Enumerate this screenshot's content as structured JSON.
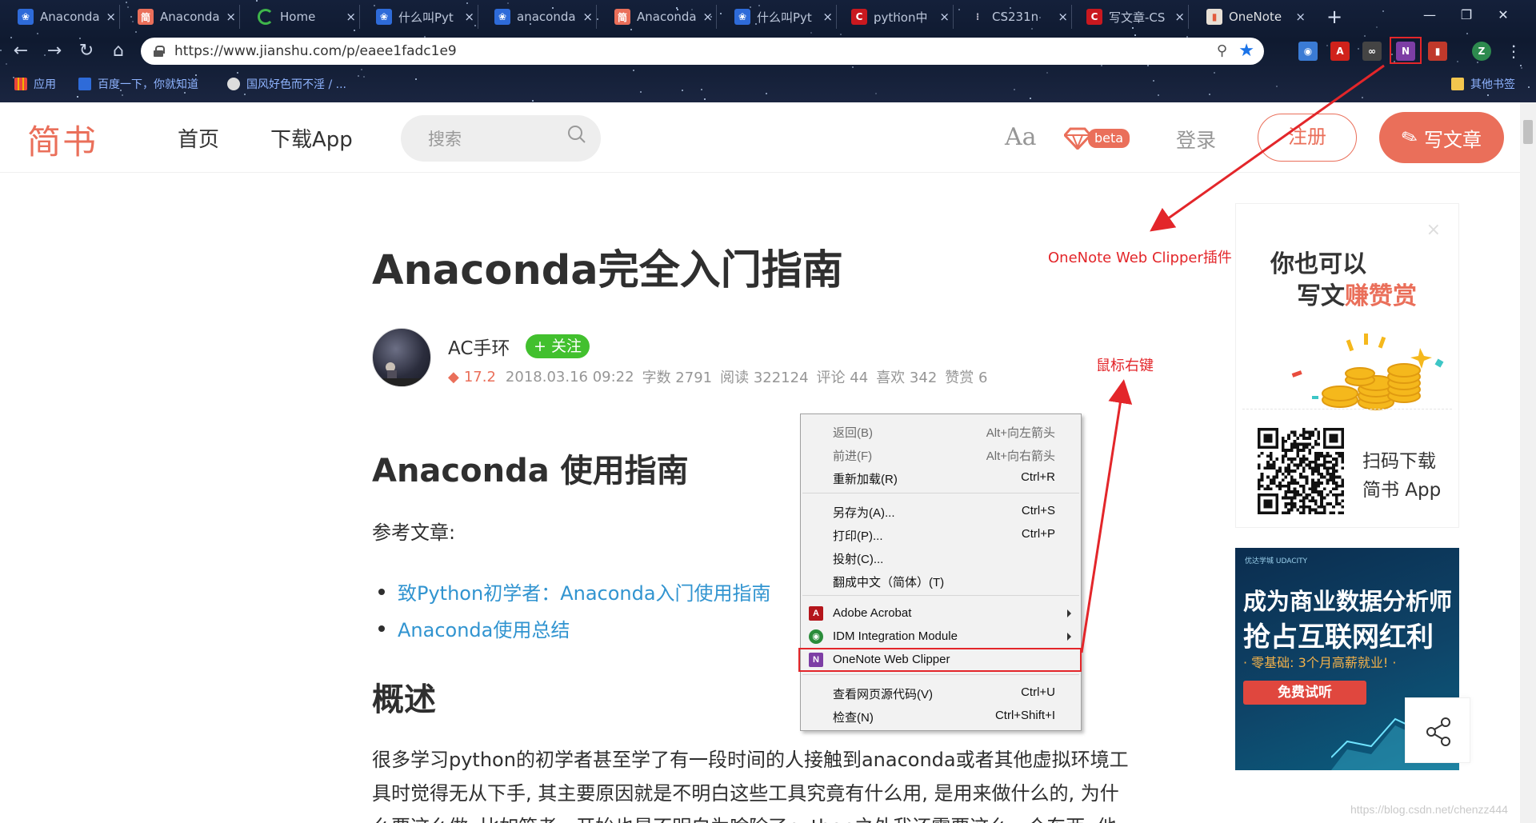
{
  "browser": {
    "tabs": [
      {
        "title": "Anaconda",
        "icon": "baidu-paw-icon"
      },
      {
        "title": "Anaconda",
        "icon": "jianshu-icon"
      },
      {
        "title": "Home",
        "icon": "loading-spinner-icon"
      },
      {
        "title": "什么叫Pyt",
        "icon": "baidu-paw-icon"
      },
      {
        "title": "anaconda",
        "icon": "baidu-paw-icon"
      },
      {
        "title": "Anaconda",
        "icon": "jianshu-icon"
      },
      {
        "title": "什么叫Pyt",
        "icon": "baidu-paw-icon"
      },
      {
        "title": "python中",
        "icon": "csdn-icon"
      },
      {
        "title": "CS231n",
        "icon": "generic-page-icon"
      },
      {
        "title": "写文章-CS",
        "icon": "csdn-icon"
      },
      {
        "title": "OneNote",
        "icon": "onenote-tab-icon"
      }
    ],
    "close_glyph": "×",
    "new_tab_glyph": "+",
    "window_controls": {
      "minimize": "—",
      "restore": "❐",
      "close": "✕"
    },
    "url": "https://www.jianshu.com/p/eaee1fadc1e9",
    "profile_letter": "Z",
    "bookmarks": [
      {
        "label": "应用",
        "icon": "apps-grid-icon"
      },
      {
        "label": "百度一下，你就知道",
        "icon": "baidu-paw-icon"
      },
      {
        "label": "国风好色而不淫 / ...",
        "icon": "globe-icon"
      }
    ],
    "other_bookmarks": "其他书签"
  },
  "site": {
    "logo": "简书",
    "nav": {
      "home": "首页",
      "download": "下载App"
    },
    "search_placeholder": "搜索",
    "font_toggle": "Aa",
    "beta_label": "beta",
    "login": "登录",
    "register": "注册",
    "write": "写文章"
  },
  "article": {
    "title": "Anaconda完全入门指南",
    "author": "AC手环",
    "follow": "+ 关注",
    "score": "17.2",
    "date": "2018.03.16 09:22",
    "words": "字数 2791",
    "reads": "阅读 322124",
    "comments": "评论 44",
    "likes": "喜欢 342",
    "rewards": "赞赏 6",
    "h2_usage": "Anaconda 使用指南",
    "ref_label": "参考文章:",
    "links": [
      "致Python初学者：Anaconda入门使用指南",
      "Anaconda使用总结"
    ],
    "h2_overview": "概述",
    "para_lines": [
      "很多学习python的初学者甚至学了有一段时间的人接触到anaconda或者其他虚拟环境工",
      "具时觉得无从下手, 其主要原因就是不明白这些工具究竟有什么用, 是用来做什么的, 为什",
      "么要这么做. 比如笔者一开始也是不明白为啥除了python之外我还需要这么一个东西, 他"
    ]
  },
  "context_menu": {
    "items": [
      {
        "label": "返回(B)",
        "shortcut": "Alt+向左箭头",
        "disabled": true
      },
      {
        "label": "前进(F)",
        "shortcut": "Alt+向右箭头",
        "disabled": true
      },
      {
        "label": "重新加载(R)",
        "shortcut": "Ctrl+R",
        "disabled": false
      },
      {
        "label": "另存为(A)...",
        "shortcut": "Ctrl+S",
        "disabled": false
      },
      {
        "label": "打印(P)...",
        "shortcut": "Ctrl+P",
        "disabled": false
      },
      {
        "label": "投射(C)...",
        "shortcut": "",
        "disabled": false
      },
      {
        "label": "翻成中文（简体）(T)",
        "shortcut": "",
        "disabled": false
      },
      {
        "label": "Adobe Acrobat",
        "shortcut": "",
        "submenu": true
      },
      {
        "label": "IDM Integration Module",
        "shortcut": "",
        "submenu": true
      },
      {
        "label": "OneNote Web Clipper",
        "shortcut": ""
      },
      {
        "label": "查看网页源代码(V)",
        "shortcut": "Ctrl+U",
        "disabled": false
      },
      {
        "label": "检查(N)",
        "shortcut": "Ctrl+Shift+I",
        "disabled": false
      }
    ]
  },
  "annotations": {
    "onenote_plugin": "OneNote Web Clipper插件",
    "right_click": "鼠标右键",
    "color": "#e3262a"
  },
  "sidebar": {
    "write_ad": {
      "line1": "你也可以",
      "line2_prefix": "写文",
      "line2_highlight": "赚赞赏",
      "close": "×",
      "scan1": "扫码下载",
      "scan2": "简书 App"
    },
    "udacity_ad": {
      "brand": "优达学城 UDACITY",
      "headline1": "成为商业数据分析师",
      "headline2": "抢占互联网红利",
      "sub": "· 零基础: 3个月高薪就业! ·",
      "cta": "免费试听"
    }
  },
  "watermark": "https://blog.csdn.net/chenzz444",
  "colors": {
    "brand": "#ea6f5a",
    "follow_green": "#42c02e",
    "link": "#3194d0",
    "annotation": "#e3262a"
  }
}
